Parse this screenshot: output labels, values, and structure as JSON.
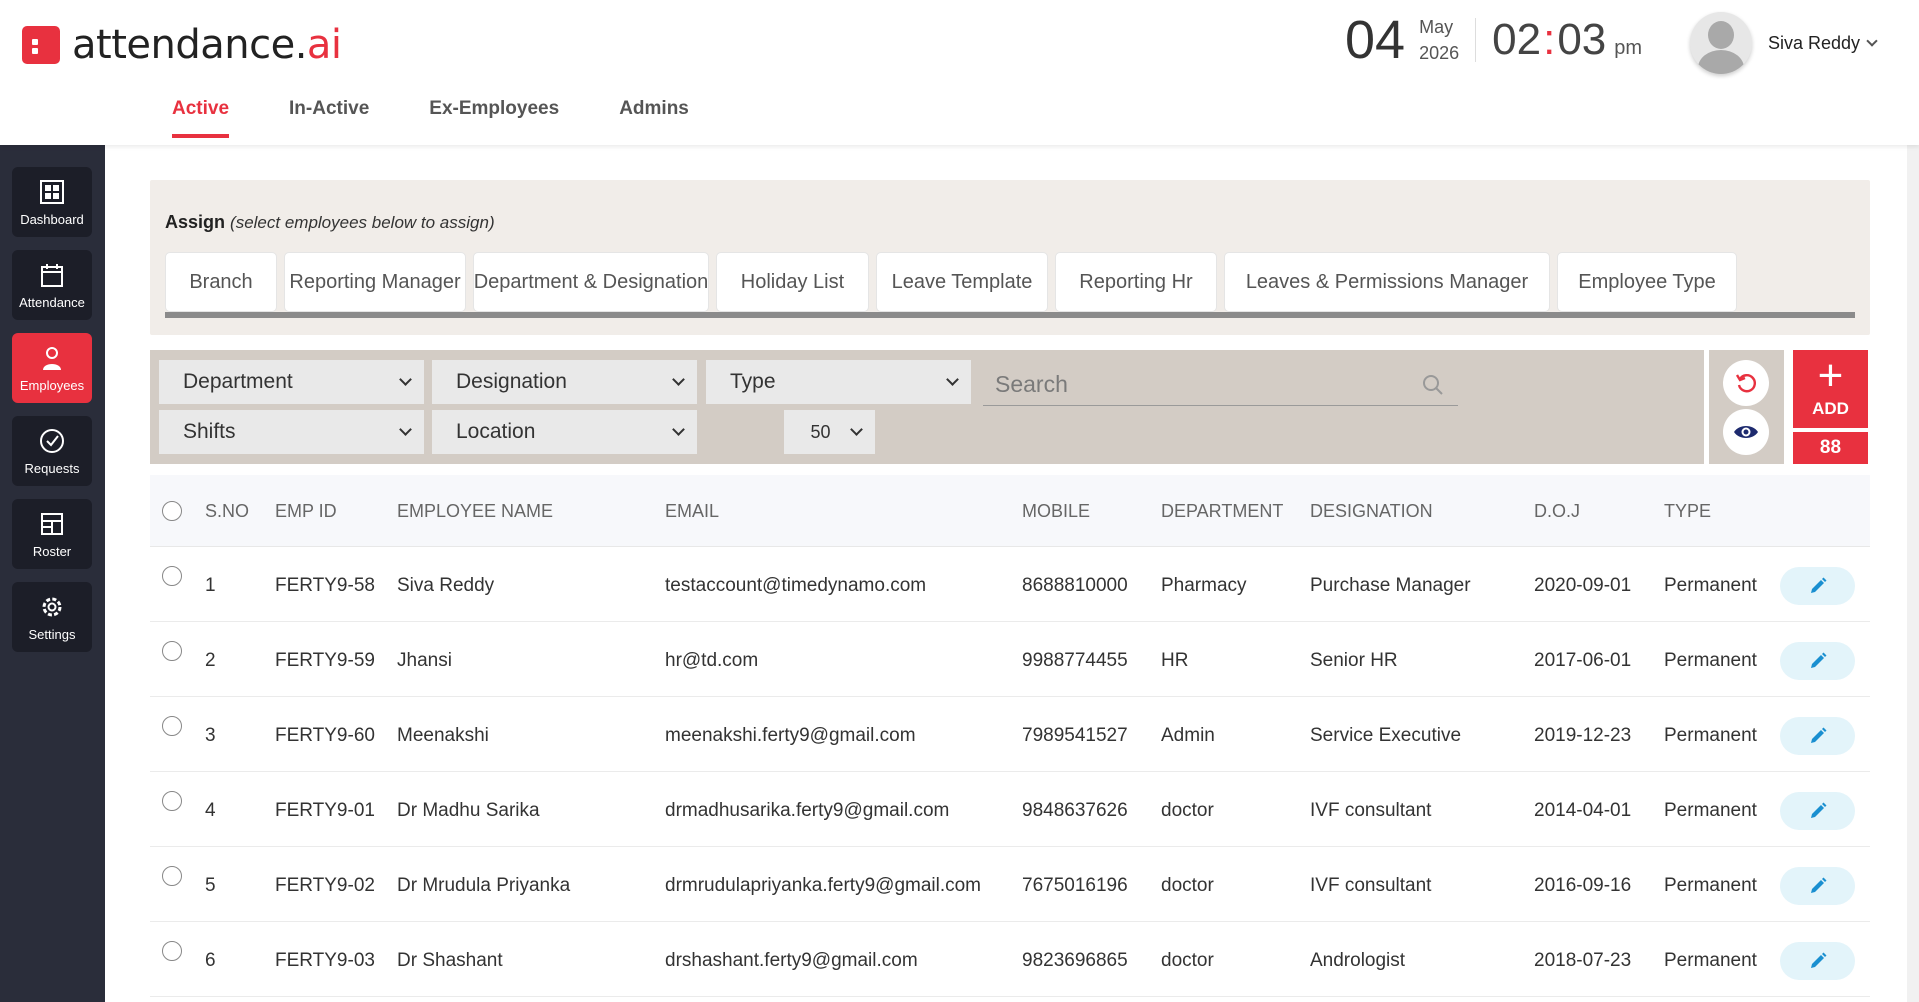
{
  "app": {
    "logo_text": "attendance.",
    "logo_accent": "ai"
  },
  "datetime": {
    "day": "04",
    "month": "May",
    "year": "2026",
    "hour": "02",
    "minute": "03",
    "ampm": "pm"
  },
  "user": {
    "name": "Siva Reddy"
  },
  "tabs": [
    {
      "label": "Active",
      "active": true
    },
    {
      "label": "In-Active"
    },
    {
      "label": "Ex-Employees"
    },
    {
      "label": "Admins"
    }
  ],
  "sidebar": {
    "items": [
      {
        "label": "Dashboard"
      },
      {
        "label": "Attendance"
      },
      {
        "label": "Employees",
        "active": true
      },
      {
        "label": "Requests"
      },
      {
        "label": "Roster"
      },
      {
        "label": "Settings"
      }
    ]
  },
  "assign": {
    "title": "Assign",
    "hint": "(select employees below to assign)",
    "buttons": [
      "Branch",
      "Reporting Manager",
      "Department & Designation",
      "Holiday List",
      "Leave Template",
      "Reporting Hr",
      "Leaves & Permissions Manager",
      "Employee Type"
    ]
  },
  "filters": {
    "department": "Department",
    "designation": "Designation",
    "type": "Type",
    "shifts": "Shifts",
    "location": "Location",
    "page_size": "50",
    "search_placeholder": "Search"
  },
  "actions": {
    "add_label": "ADD",
    "count": "88"
  },
  "table": {
    "headers": [
      "S.NO",
      "EMP ID",
      "EMPLOYEE NAME",
      "EMAIL",
      "MOBILE",
      "DEPARTMENT",
      "DESIGNATION",
      "D.O.J",
      "TYPE"
    ],
    "rows": [
      {
        "sno": "1",
        "emp_id": "FERTY9-58",
        "name": "Siva Reddy",
        "email": "testaccount@timedynamo.com",
        "mobile": "8688810000",
        "department": "Pharmacy",
        "designation": "Purchase Manager",
        "doj": "2020-09-01",
        "type": "Permanent"
      },
      {
        "sno": "2",
        "emp_id": "FERTY9-59",
        "name": "Jhansi",
        "email": "hr@td.com",
        "mobile": "9988774455",
        "department": "HR",
        "designation": "Senior HR",
        "doj": "2017-06-01",
        "type": "Permanent"
      },
      {
        "sno": "3",
        "emp_id": "FERTY9-60",
        "name": "Meenakshi",
        "email": "meenakshi.ferty9@gmail.com",
        "mobile": "7989541527",
        "department": "Admin",
        "designation": "Service Executive",
        "doj": "2019-12-23",
        "type": "Permanent"
      },
      {
        "sno": "4",
        "emp_id": "FERTY9-01",
        "name": "Dr Madhu Sarika",
        "email": "drmadhusarika.ferty9@gmail.com",
        "mobile": "9848637626",
        "department": "doctor",
        "designation": "IVF consultant",
        "doj": "2014-04-01",
        "type": "Permanent"
      },
      {
        "sno": "5",
        "emp_id": "FERTY9-02",
        "name": "Dr Mrudula Priyanka",
        "email": "drmrudulapriyanka.ferty9@gmail.com",
        "mobile": "7675016196",
        "department": "doctor",
        "designation": "IVF consultant",
        "doj": "2016-09-16",
        "type": "Permanent"
      },
      {
        "sno": "6",
        "emp_id": "FERTY9-03",
        "name": "Dr Shashant",
        "email": "drshashant.ferty9@gmail.com",
        "mobile": "9823696865",
        "department": "doctor",
        "designation": "Andrologist",
        "doj": "2018-07-23",
        "type": "Permanent"
      }
    ]
  },
  "colors": {
    "accent": "#e8313f",
    "sidebar_bg": "#2a2d3a",
    "filter_bg": "#d3ccc5"
  }
}
